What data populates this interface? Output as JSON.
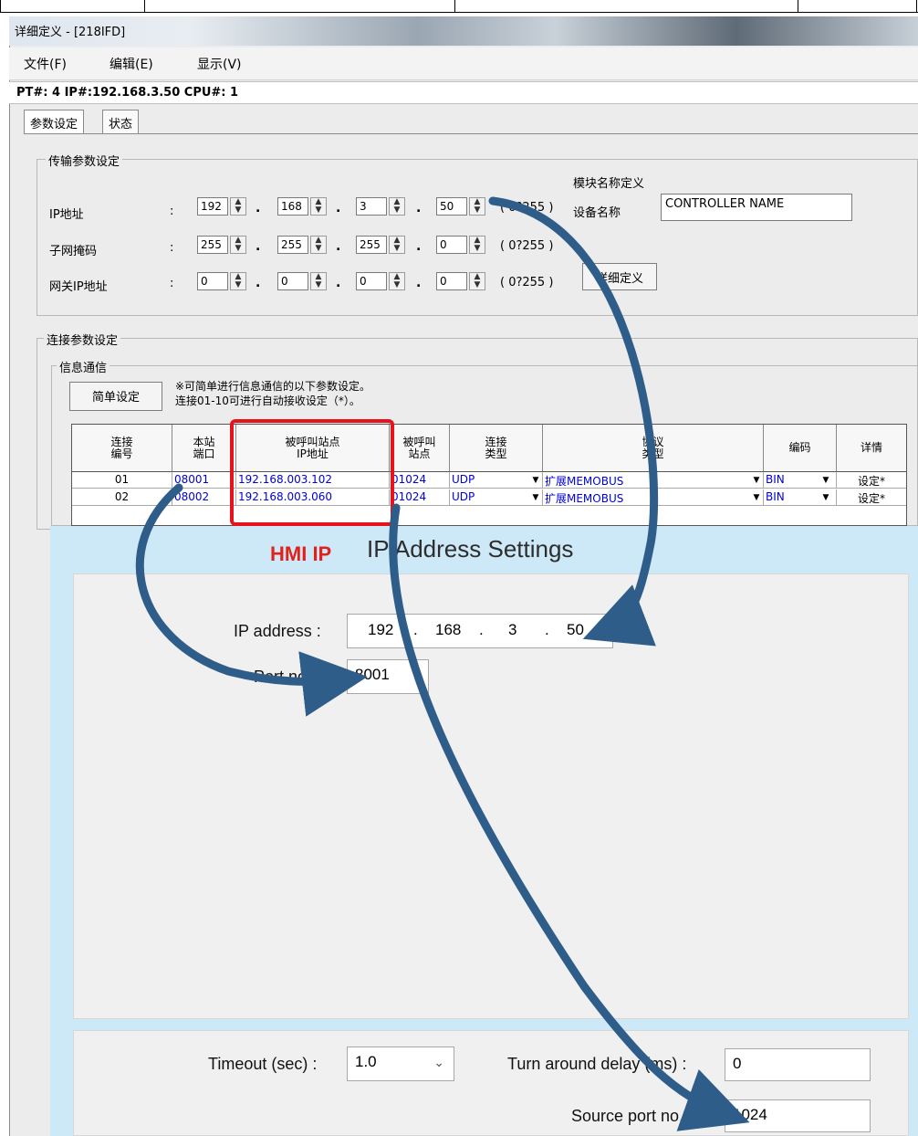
{
  "window": {
    "title": "详细定义 - [218IFD]"
  },
  "menu": {
    "file": "文件(F)",
    "edit": "编辑(E)",
    "view": "显示(V)"
  },
  "info": "PT#: 4 IP#:192.168.3.50 CPU#: 1",
  "tabs": {
    "params": "参数设定",
    "status": "状态"
  },
  "transfer": {
    "group_label": "传输参数设定",
    "module_label": "模块名称定义",
    "device_name_label": "设备名称",
    "device_name_value": "CONTROLLER NAME",
    "ip_label": "IP地址",
    "mask_label": "子网掩码",
    "gateway_label": "网关IP地址",
    "colon": ":",
    "ip": [
      "192",
      "168",
      "3",
      "50"
    ],
    "mask": [
      "255",
      "255",
      "255",
      "0"
    ],
    "gateway": [
      "0",
      "0",
      "0",
      "0"
    ],
    "range_ip": "( 0?255 )",
    "range_mask": "( 0?255 )",
    "range_gateway": "( 0?255 )",
    "detail_button": "详细定义"
  },
  "connection": {
    "group_label": "连接参数设定",
    "sub_label": "信息通信",
    "simple_button": "简单设定",
    "note_line1": "※可简单进行信息通信的以下参数设定。",
    "note_line2": "连接01-10可进行自动接收设定（*）。",
    "headers": [
      "连接\n编号",
      "本站\n端口",
      "被呼叫站点\nIP地址",
      "被呼叫\n站点",
      "连接\n类型",
      "协议\n类型",
      "编码",
      "详情"
    ],
    "rows": [
      {
        "no": "01",
        "port": "08001",
        "ip": "192.168.003.102",
        "rport": "01024",
        "ctype": "UDP",
        "proto": "扩展MEMOBUS",
        "code": "BIN",
        "detail": "设定*"
      },
      {
        "no": "02",
        "port": "08002",
        "ip": "192.168.003.060",
        "rport": "01024",
        "ctype": "UDP",
        "proto": "扩展MEMOBUS",
        "code": "BIN",
        "detail": "设定*"
      }
    ]
  },
  "dialog": {
    "hmi_label": "HMI IP",
    "title": "IP Address Settings",
    "ip_label": "IP address :",
    "ip": [
      "192",
      "168",
      "3",
      "50"
    ],
    "ip_dot": ".",
    "port_label": "Port no.:",
    "port_value": "8001",
    "timeout_label": "Timeout (sec) :",
    "timeout_value": "1.0",
    "turnaround_label": "Turn around delay (ms) :",
    "turnaround_value": "0",
    "source_port_label": "Source port no. :",
    "source_port_value": "1024"
  },
  "colors": {
    "arrow": "#2f5d8a",
    "highlight": "#e8121c",
    "dialog_bg": "#cde8f7",
    "link_text": "#0000d8"
  },
  "icons": [
    "spin-arrows-icon",
    "dropdown-arrow-icon",
    "chevron-down-icon"
  ]
}
